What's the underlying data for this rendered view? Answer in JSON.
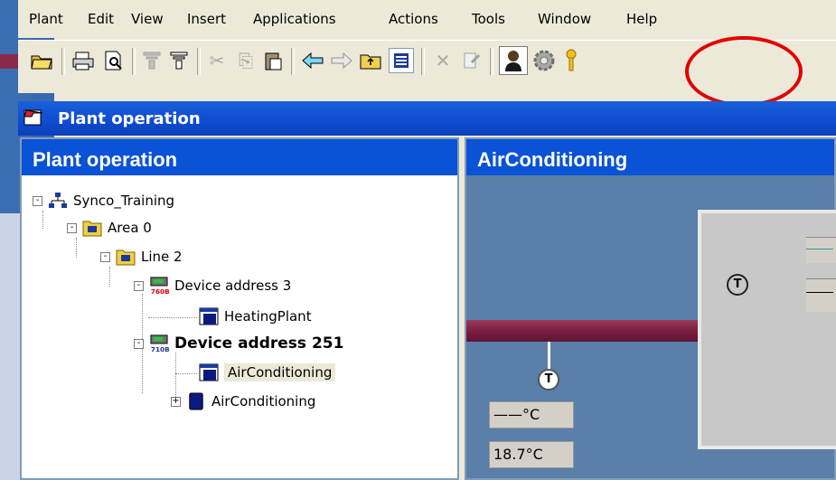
{
  "menu": [
    "Plant",
    "Edit",
    "View",
    "Insert",
    "Applications",
    "Actions",
    "Tools",
    "Window",
    "Help"
  ],
  "toolbar_icons": [
    "open-folder-icon",
    "print-icon",
    "print-preview-icon",
    "filter-icon",
    "filter-active-icon",
    "cut-icon",
    "copy-icon",
    "paste-icon",
    "back-arrow-icon",
    "forward-arrow-icon",
    "up-folder-icon",
    "list-view-icon",
    "delete-icon",
    "properties-icon",
    "user-icon",
    "settings-gear-icon",
    "key-icon"
  ],
  "window": {
    "title": "Plant operation"
  },
  "tree_pane": {
    "header": "Plant operation",
    "items": [
      {
        "label": "Synco_Training",
        "level": 0,
        "expand": "-",
        "bold": false
      },
      {
        "label": "Area 0",
        "level": 1,
        "expand": "-",
        "bold": false
      },
      {
        "label": "Line 2",
        "level": 2,
        "expand": "-",
        "bold": false
      },
      {
        "label": "Device address 3",
        "level": 3,
        "expand": "-",
        "bold": false,
        "tag": "760B"
      },
      {
        "label": "HeatingPlant",
        "level": 4,
        "expand": "",
        "bold": false
      },
      {
        "label": "Device address 251",
        "level": 3,
        "expand": "-",
        "bold": true,
        "tag": "710B"
      },
      {
        "label": "AirConditioning",
        "level": 4,
        "expand": "",
        "bold": false,
        "selected": true
      },
      {
        "label": "AirConditioning",
        "level": 4,
        "expand": "+",
        "bold": false
      }
    ]
  },
  "detail_pane": {
    "header": "AirConditioning",
    "sensor_symbol": "T",
    "value_unset": "——°C",
    "value_temp": "18.7°C"
  },
  "colors": {
    "accent": "#0a52d6",
    "highlight": "#e00000"
  }
}
